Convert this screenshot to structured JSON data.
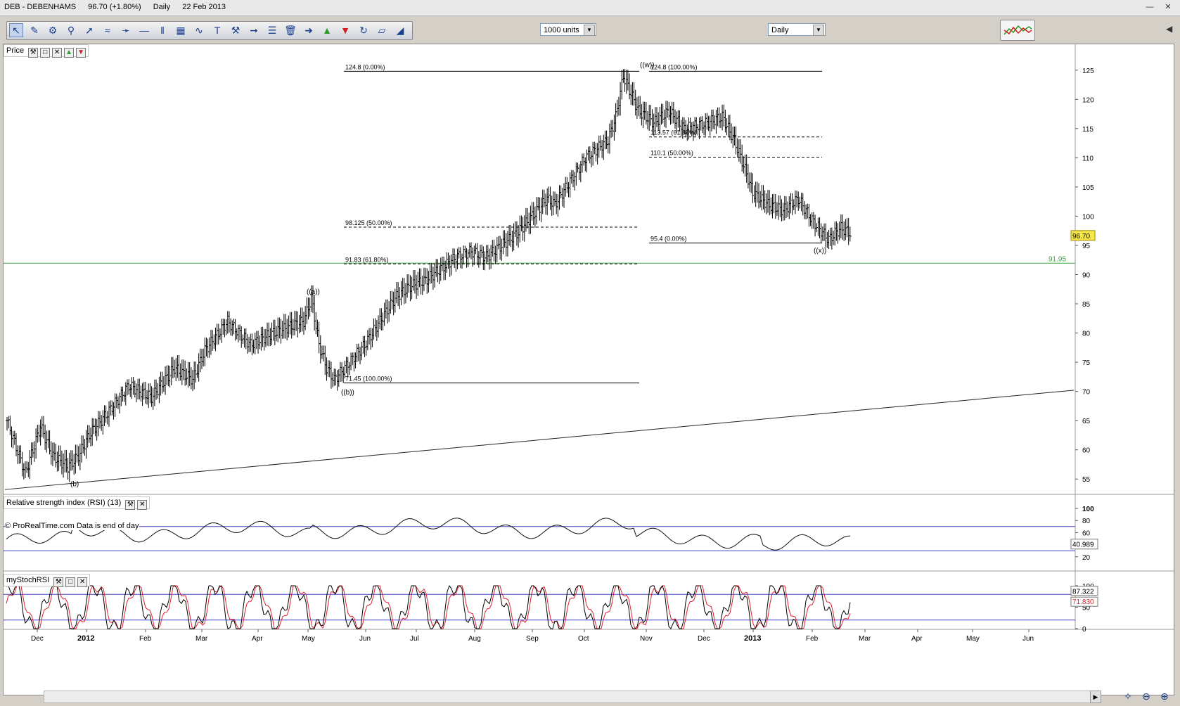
{
  "window": {
    "symbol": "DEB - DEBENHAMS",
    "price_change": "96.70 (+1.80%)",
    "period": "Daily",
    "date": "22 Feb 2013"
  },
  "toolbar": {
    "units_select": "1000 units",
    "period_select": "Daily",
    "tools": [
      "cursor-icon",
      "ruler-icon",
      "alarm-icon",
      "zoom-icon",
      "line-icon",
      "channel-icon",
      "trendline-icon",
      "horizontal-line-icon",
      "vertical-line-icon",
      "fibonacci-icon",
      "wave-icon",
      "text-icon",
      "hammer-icon",
      "arrow-line-icon",
      "fan-icon",
      "trash-icon",
      "right-arrow-icon",
      "up-arrow-icon",
      "down-arrow-icon",
      "cycle-icon",
      "pitchfork-icon",
      "gann-icon"
    ]
  },
  "panels": {
    "price_label": "Price",
    "rsi_label": "Relative strength index (RSI) (13)",
    "stoch_label": "myStochRSI",
    "copyright": "© ProRealTime.com  Data is end of day"
  },
  "chart_data": [
    {
      "type": "ohlc",
      "title": "DEB - DEBENHAMS Daily",
      "x_labels": [
        "Dec",
        "2012",
        "Feb",
        "Mar",
        "Apr",
        "May",
        "Jun",
        "Jul",
        "Aug",
        "Sep",
        "Oct",
        "Nov",
        "Dec",
        "2013",
        "Feb",
        "Mar",
        "Apr",
        "May",
        "Jun"
      ],
      "y_ticks": [
        55,
        60,
        65,
        70,
        75,
        80,
        85,
        90,
        95,
        100,
        105,
        110,
        115,
        120,
        125
      ],
      "ylim": [
        52.5,
        127.5
      ],
      "last_price": "96.70",
      "horizontal_line": {
        "label": "91.95",
        "value": 91.95,
        "color": "#3aa63a"
      },
      "trendline": {
        "from_price": 53.2,
        "to_price": 70.2
      },
      "close_path": [
        [
          0,
          65
        ],
        [
          12,
          56
        ],
        [
          22,
          64
        ],
        [
          30,
          59
        ],
        [
          40,
          57
        ],
        [
          47,
          59
        ],
        [
          55,
          63
        ],
        [
          65,
          66
        ],
        [
          80,
          71
        ],
        [
          95,
          69
        ],
        [
          110,
          74
        ],
        [
          122,
          72
        ],
        [
          130,
          77
        ],
        [
          145,
          82
        ],
        [
          160,
          78
        ],
        [
          175,
          80
        ],
        [
          185,
          81
        ],
        [
          195,
          82
        ],
        [
          200,
          86
        ],
        [
          205,
          78
        ],
        [
          210,
          74
        ],
        [
          215,
          72
        ],
        [
          225,
          75
        ],
        [
          235,
          78
        ],
        [
          245,
          82
        ],
        [
          255,
          86
        ],
        [
          265,
          88
        ],
        [
          275,
          89
        ],
        [
          285,
          91
        ],
        [
          295,
          93
        ],
        [
          305,
          94
        ],
        [
          315,
          93
        ],
        [
          325,
          95
        ],
        [
          335,
          97
        ],
        [
          345,
          100
        ],
        [
          355,
          103
        ],
        [
          360,
          102
        ],
        [
          370,
          106
        ],
        [
          380,
          110
        ],
        [
          390,
          112
        ],
        [
          395,
          113
        ],
        [
          400,
          117
        ],
        [
          405,
          124
        ],
        [
          410,
          121
        ],
        [
          415,
          118
        ],
        [
          425,
          116
        ],
        [
          435,
          118
        ],
        [
          445,
          115
        ],
        [
          460,
          116
        ],
        [
          470,
          117
        ],
        [
          478,
          113
        ],
        [
          485,
          108
        ],
        [
          490,
          104
        ],
        [
          500,
          102
        ],
        [
          510,
          101
        ],
        [
          520,
          103
        ],
        [
          530,
          99
        ],
        [
          540,
          96
        ],
        [
          548,
          98
        ],
        [
          555,
          97
        ]
      ],
      "wave_labels": [
        {
          "text": "((a))",
          "value": 85.7
        },
        {
          "text": "((b))",
          "value": 71.4
        },
        {
          "text": "((w))",
          "value": 124.8
        },
        {
          "text": "((x))",
          "value": 95.4
        },
        {
          "text": "(b)",
          "value": 55.2
        }
      ],
      "fibonacci": [
        {
          "label": "124.8 (0.00%)",
          "value": 124.8,
          "style": "solid",
          "group": "left"
        },
        {
          "label": "98.125 (50.00%)",
          "value": 98.125,
          "style": "dashed",
          "group": "left"
        },
        {
          "label": "91.83 (61.80%)",
          "value": 91.83,
          "style": "dashed",
          "group": "left"
        },
        {
          "label": "71.45 (100.00%)",
          "value": 71.45,
          "style": "solid",
          "group": "left"
        },
        {
          "label": "124.8 (100.00%)",
          "value": 124.8,
          "style": "solid",
          "group": "right"
        },
        {
          "label": "113.57 (61.80%)",
          "value": 113.57,
          "style": "dashed",
          "group": "right"
        },
        {
          "label": "110.1 (50.00%)",
          "value": 110.1,
          "style": "dashed",
          "group": "right"
        },
        {
          "label": "95.4 (0.00%)",
          "value": 95.4,
          "style": "solid",
          "group": "right"
        }
      ]
    },
    {
      "type": "line",
      "title": "Relative strength index (RSI) (13)",
      "y_ticks": [
        20,
        40,
        60,
        80,
        100
      ],
      "ylim": [
        0,
        100
      ],
      "levels": [
        70,
        30
      ],
      "last_value": "40.989"
    },
    {
      "type": "line",
      "title": "myStochRSI",
      "y_ticks": [
        0,
        50,
        100
      ],
      "ylim": [
        0,
        100
      ],
      "levels": [
        80,
        20
      ],
      "last_values": [
        "87.322",
        "71.830"
      ],
      "series_colors": [
        "#000000",
        "#e0202e"
      ]
    }
  ],
  "colors": {
    "accent": "#3aa63a",
    "rsi_fill": "#c49a96",
    "level": "#4040c0",
    "price_badge": "#f5e64a"
  }
}
